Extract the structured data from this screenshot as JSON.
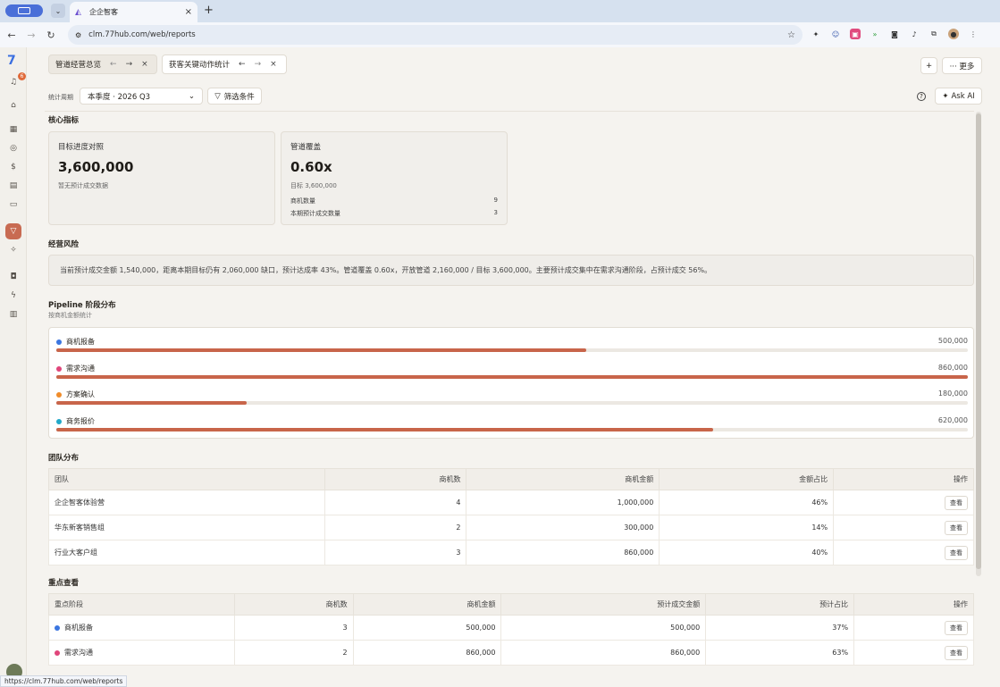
{
  "browser": {
    "tab_title": "企企智客",
    "url": "clm.77hub.com/web/reports",
    "status_url": "https://clm.77hub.com/web/reports"
  },
  "rail": {
    "notification_count": "6"
  },
  "doc_tabs": [
    {
      "label": "管道经营总览"
    },
    {
      "label": "获客关键动作统计"
    }
  ],
  "header": {
    "more_label": "··· 更多",
    "add_label": "+"
  },
  "filter": {
    "period_label": "统计周期",
    "period_value": "本季度 · 2026 Q3",
    "filter_button": "筛选条件",
    "ask_ai": "Ask AI"
  },
  "kpi": {
    "section_title": "核心指标",
    "cards": [
      {
        "label": "目标进度对照",
        "value": "3,600,000",
        "sub": "暂无预计成交数据"
      },
      {
        "label": "管道覆盖",
        "value": "0.60x",
        "sub": "目标 3,600,000",
        "rows": [
          {
            "k": "商机数量",
            "v": "9"
          },
          {
            "k": "本期预计成交数量",
            "v": "3"
          }
        ]
      }
    ]
  },
  "risk": {
    "section_title": "经营风险",
    "text": "当前预计成交金额 1,540,000，距离本期目标仍有 2,060,000 缺口，预计达成率 43%。管道覆盖 0.60x，开放管道 2,160,000 / 目标 3,600,000。主要预计成交集中在需求沟通阶段，占预计成交 56%。"
  },
  "pipeline": {
    "section_title": "Pipeline 阶段分布",
    "subtitle": "按商机金额统计",
    "max": 860000,
    "stages": [
      {
        "name": "商机报备",
        "amount_label": "500,000",
        "amount": 500000,
        "dot_color": "#3b76e0"
      },
      {
        "name": "需求沟通",
        "amount_label": "860,000",
        "amount": 860000,
        "dot_color": "#e0457a"
      },
      {
        "name": "方案确认",
        "amount_label": "180,000",
        "amount": 180000,
        "dot_color": "#f08c2a"
      },
      {
        "name": "商务报价",
        "amount_label": "620,000",
        "amount": 620000,
        "dot_color": "#22a8c8"
      }
    ]
  },
  "team": {
    "section_title": "团队分布",
    "headers": [
      "团队",
      "商机数",
      "商机金额",
      "金额占比",
      "操作"
    ],
    "rows": [
      {
        "team": "企企智客体验营",
        "count": "4",
        "amount": "1,000,000",
        "share": "46%",
        "action": "查看"
      },
      {
        "team": "华东新客销售组",
        "count": "2",
        "amount": "300,000",
        "share": "14%",
        "action": "查看"
      },
      {
        "team": "行业大客户组",
        "count": "3",
        "amount": "860,000",
        "share": "40%",
        "action": "查看"
      }
    ]
  },
  "focus": {
    "section_title": "重点查看",
    "headers": [
      "重点阶段",
      "商机数",
      "商机金额",
      "预计成交金额",
      "预计占比",
      "操作"
    ],
    "rows": [
      {
        "stage": "商机报备",
        "dot_color": "#3b76e0",
        "count": "3",
        "amount": "500,000",
        "expected": "500,000",
        "share": "37%",
        "action": "查看"
      },
      {
        "stage": "需求沟通",
        "dot_color": "#e0457a",
        "count": "2",
        "amount": "860,000",
        "expected": "860,000",
        "share": "63%",
        "action": "查看"
      }
    ]
  }
}
